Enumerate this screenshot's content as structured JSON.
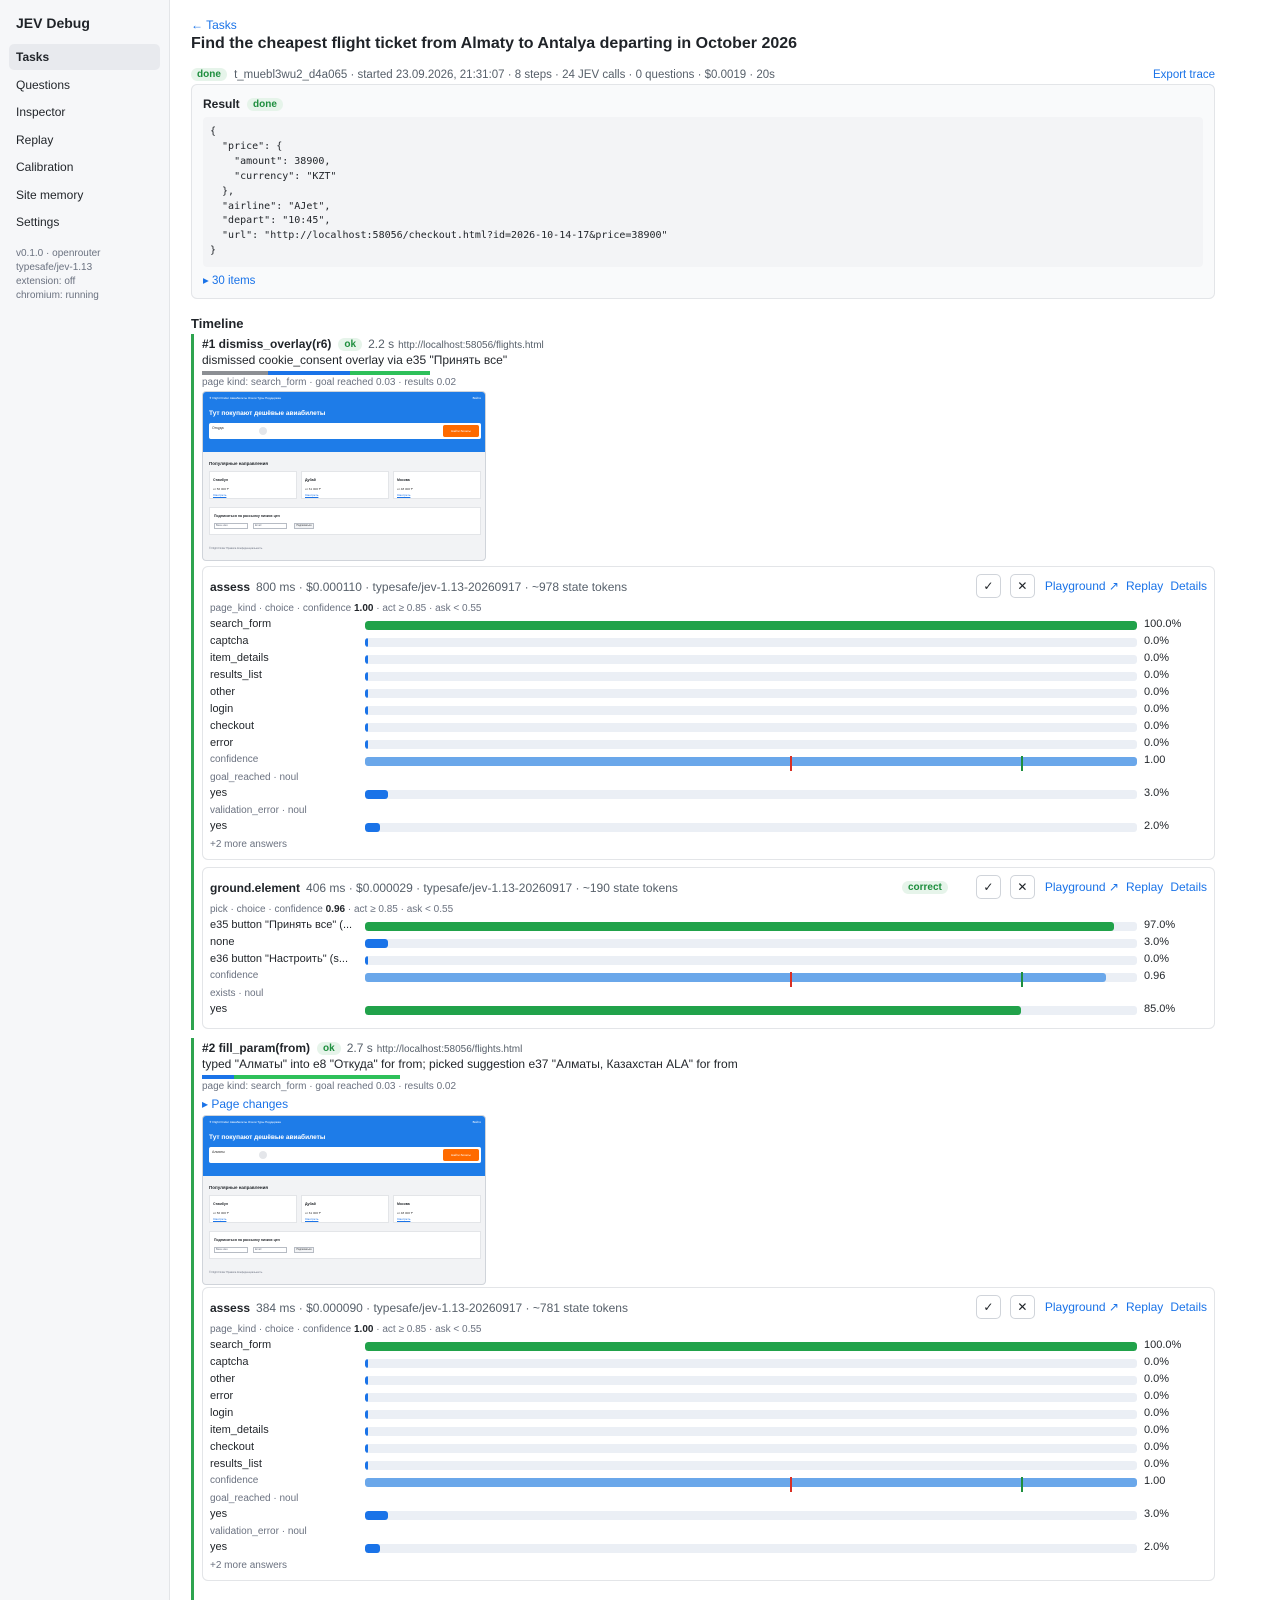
{
  "sidebar": {
    "brand": "JEV Debug",
    "items": [
      {
        "label": "Tasks"
      },
      {
        "label": "Questions"
      },
      {
        "label": "Inspector"
      },
      {
        "label": "Replay"
      },
      {
        "label": "Calibration"
      },
      {
        "label": "Site memory"
      },
      {
        "label": "Settings"
      }
    ],
    "sysinfo": {
      "line1": "v0.1.0 · openrouter",
      "line2": "typesafe/jev-1.13",
      "line3": "extension: off",
      "line4": "chromium: running"
    }
  },
  "task": {
    "back": "← Tasks",
    "title": "Find the cheapest flight ticket from Almaty to Antalya departing in October 2026",
    "status": "done",
    "meta": "t_muebl3wu2_d4a065 · started 23.09.2026, 21:31:07  · 8 steps · 24 JEV calls · 0 questions · $0.0019 · 20s",
    "export": "Export trace"
  },
  "result": {
    "label": "Result",
    "status": "done",
    "json": "{\n  \"price\": {\n    \"amount\": 38900,\n    \"currency\": \"KZT\"\n  },\n  \"airline\": \"AJet\",\n  \"depart\": \"10:45\",\n  \"url\": \"http://localhost:58056/checkout.html?id=2026-10-14-17&price=38900\"\n}",
    "items": "▸ 30 items"
  },
  "timeline": {
    "heading": "Timeline",
    "actions": {
      "playground": "Playground ↗",
      "replay": "Replay",
      "details": "Details",
      "approve": "✓",
      "reject": "✕"
    },
    "steps": [
      {
        "name": "#1 dismiss_overlay(r6)",
        "status": "ok",
        "duration": "2.2 s",
        "url": "http://localhost:58056/flights.html",
        "desc": "dismissed cookie_consent overlay via e35 \"Принять все\"",
        "segments": [
          {
            "color": "#8c8f94",
            "frac": 0.29
          },
          {
            "color": "#1a73e8",
            "frac": 0.36
          },
          {
            "color": "#2ec05a",
            "frac": 0.35
          }
        ],
        "meta": "page kind: search_form · goal reached 0.03 · results 0.02",
        "thumb": {
          "nav": "✈ Flight Finder   Авиабилеты   Отели   Туры   Поддержка",
          "nav_right": "Войти",
          "headline": "Тут покупают дешёвые авиабилеты",
          "from": "Откуда",
          "button": "Найти билеты",
          "section": "Популярные направления",
          "cities": [
            {
              "name": "Стамбул",
              "price": "от 56 000 ₸",
              "link": "Смотреть"
            },
            {
              "name": "Дубай",
              "price": "от 61 000 ₸",
              "link": "Смотреть"
            },
            {
              "name": "Москва",
              "price": "от 48 000 ₸",
              "link": "Смотреть"
            }
          ],
          "subscribe": "Подписаться на рассылку низких цен",
          "name_ph": "Ваше имя",
          "email_ph": "Email",
          "sub_btn": "Подписаться",
          "footer": "© Flight Finder  Правила  Конфиденциальность"
        },
        "calls": [
          {
            "name": "assess",
            "stats": "800 ms · $0.000110 · typesafe/jev-1.13-20260917 · ~978 state tokens",
            "groups": [
              {
                "sub_pre": "page_kind · choice · confidence ",
                "sub_bold": "1.00",
                "sub_post": " · act ≥ 0.85 · ask < 0.55",
                "rows": [
                  {
                    "label": "search_form",
                    "value": 1.0,
                    "pct": "100.0%"
                  },
                  {
                    "label": "captcha",
                    "value": 0.0,
                    "pct": "0.0%"
                  },
                  {
                    "label": "item_details",
                    "value": 0.0,
                    "pct": "0.0%"
                  },
                  {
                    "label": "results_list",
                    "value": 0.0,
                    "pct": "0.0%"
                  },
                  {
                    "label": "other",
                    "value": 0.0,
                    "pct": "0.0%"
                  },
                  {
                    "label": "login",
                    "value": 0.0,
                    "pct": "0.0%"
                  },
                  {
                    "label": "checkout",
                    "value": 0.0,
                    "pct": "0.0%"
                  },
                  {
                    "label": "error",
                    "value": 0.0,
                    "pct": "0.0%"
                  }
                ],
                "confidence": {
                  "label": "confidence",
                  "value": 1.0,
                  "pct": "1.00",
                  "ask": 0.55,
                  "act": 0.85
                }
              },
              {
                "sub_pre": "goal_reached · noul",
                "rows": [
                  {
                    "label": "yes",
                    "value": 0.03,
                    "pct": "3.0%"
                  }
                ]
              },
              {
                "sub_pre": "validation_error · noul",
                "rows": [
                  {
                    "label": "yes",
                    "value": 0.02,
                    "pct": "2.0%"
                  }
                ]
              }
            ],
            "more": "+2 more answers"
          },
          {
            "name": "ground.element",
            "stats": "406 ms · $0.000029 · typesafe/jev-1.13-20260917 · ~190 state tokens",
            "verdict": "correct",
            "groups": [
              {
                "sub_pre": "pick · choice · confidence ",
                "sub_bold": "0.96",
                "sub_post": " · act ≥ 0.85 · ask < 0.55",
                "rows": [
                  {
                    "label": "e35 button \"Принять все\" (...",
                    "value": 0.97,
                    "pct": "97.0%"
                  },
                  {
                    "label": "none",
                    "value": 0.03,
                    "pct": "3.0%"
                  },
                  {
                    "label": "e36 button \"Настроить\" (s...",
                    "value": 0.0,
                    "pct": "0.0%"
                  }
                ],
                "confidence": {
                  "label": "confidence",
                  "value": 0.96,
                  "pct": "0.96",
                  "ask": 0.55,
                  "act": 0.85
                }
              },
              {
                "sub_pre": "exists · noul",
                "rows": [
                  {
                    "label": "yes",
                    "value": 0.85,
                    "pct": "85.0%",
                    "color": "green"
                  }
                ]
              }
            ]
          }
        ]
      },
      {
        "name": "#2 fill_param(from)",
        "status": "ok",
        "duration": "2.7 s",
        "url": "http://localhost:58056/flights.html",
        "desc": "typed \"Алматы\" into e8 \"Откуда\" for from; picked suggestion e37 \"Алматы, Казахстан ALA\" for from",
        "segments": [
          {
            "color": "#1a73e8",
            "frac": 0.14
          },
          {
            "color": "#2ec05a",
            "frac": 0.73
          }
        ],
        "meta": "page kind: search_form · goal reached 0.03 · results 0.02",
        "page_changes": "▸ Page changes",
        "thumb": {
          "nav": "✈ Flight Finder   Авиабилеты   Отели   Туры   Поддержка",
          "nav_right": "Войти",
          "headline": "Тут покупают дешёвые авиабилеты",
          "from": "Алматы",
          "button": "Найти билеты",
          "section": "Популярные направления",
          "cities": [
            {
              "name": "Стамбул",
              "price": "от 56 000 ₸",
              "link": "Смотреть"
            },
            {
              "name": "Дубай",
              "price": "от 61 000 ₸",
              "link": "Смотреть"
            },
            {
              "name": "Москва",
              "price": "от 48 000 ₸",
              "link": "Смотреть"
            }
          ],
          "subscribe": "Подписаться на рассылку низких цен",
          "name_ph": "Ваше имя",
          "email_ph": "Email",
          "sub_btn": "Подписаться",
          "footer": "© Flight Finder  Правила  Конфиденциальность"
        },
        "calls": [
          {
            "name": "assess",
            "stats": "384 ms · $0.000090 · typesafe/jev-1.13-20260917 · ~781 state tokens",
            "groups": [
              {
                "sub_pre": "page_kind · choice · confidence ",
                "sub_bold": "1.00",
                "sub_post": " · act ≥ 0.85 · ask < 0.55",
                "rows": [
                  {
                    "label": "search_form",
                    "value": 1.0,
                    "pct": "100.0%"
                  },
                  {
                    "label": "captcha",
                    "value": 0.0,
                    "pct": "0.0%"
                  },
                  {
                    "label": "other",
                    "value": 0.0,
                    "pct": "0.0%"
                  },
                  {
                    "label": "error",
                    "value": 0.0,
                    "pct": "0.0%"
                  },
                  {
                    "label": "login",
                    "value": 0.0,
                    "pct": "0.0%"
                  },
                  {
                    "label": "item_details",
                    "value": 0.0,
                    "pct": "0.0%"
                  },
                  {
                    "label": "checkout",
                    "value": 0.0,
                    "pct": "0.0%"
                  },
                  {
                    "label": "results_list",
                    "value": 0.0,
                    "pct": "0.0%"
                  }
                ],
                "confidence": {
                  "label": "confidence",
                  "value": 1.0,
                  "pct": "1.00",
                  "ask": 0.55,
                  "act": 0.85
                }
              },
              {
                "sub_pre": "goal_reached · noul",
                "rows": [
                  {
                    "label": "yes",
                    "value": 0.03,
                    "pct": "3.0%"
                  }
                ]
              },
              {
                "sub_pre": "validation_error · noul",
                "rows": [
                  {
                    "label": "yes",
                    "value": 0.02,
                    "pct": "2.0%"
                  }
                ]
              }
            ],
            "more": "+2 more answers"
          }
        ]
      }
    ]
  }
}
